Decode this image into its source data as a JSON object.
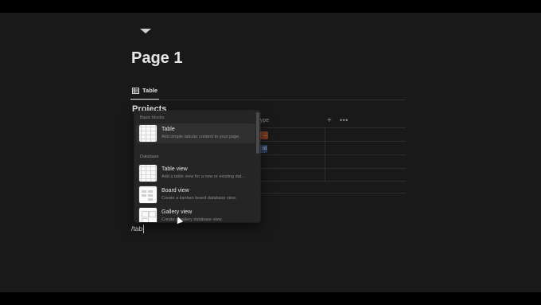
{
  "page": {
    "title": "Page 1",
    "view_tab_label": "Table",
    "database_title": "Projects",
    "columns": {
      "type": "Type"
    },
    "rows": [
      {
        "tag": "…"
      },
      {
        "tag": "rd"
      }
    ],
    "editor_text": "/tab"
  },
  "menu": {
    "sections": [
      {
        "label": "Basic blocks",
        "items": [
          {
            "title": "Table",
            "description": "Add simple tabular content to your page.",
            "icon": "table-thumbnail"
          }
        ]
      },
      {
        "label": "Database",
        "items": [
          {
            "title": "Table view",
            "description": "Add a table view for a new or existing dat...",
            "icon": "table-view-thumbnail"
          },
          {
            "title": "Board view",
            "description": "Create a kanban board database view.",
            "icon": "board-view-thumbnail"
          },
          {
            "title": "Gallery view",
            "description": "Create a gallery database view.",
            "icon": "gallery-view-thumbnail"
          }
        ]
      }
    ]
  },
  "colors": {
    "background": "#191919",
    "menu_bg": "#252525",
    "selected_item": "#303030",
    "text": "#e6e6e6",
    "muted": "#8a8a8a"
  }
}
